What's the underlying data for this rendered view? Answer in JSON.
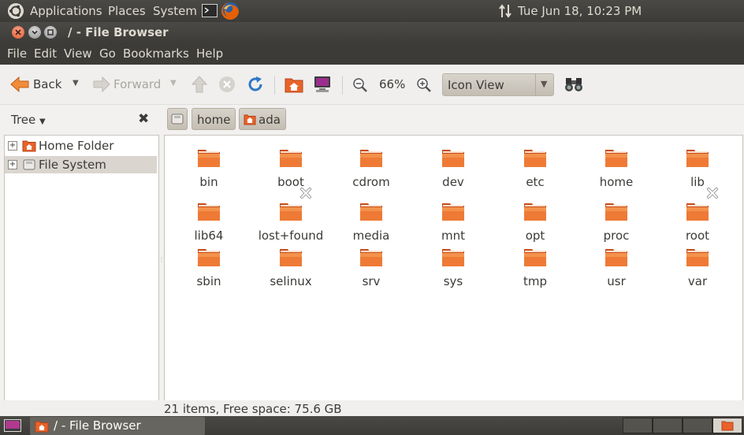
{
  "top_panel": {
    "menus": [
      "Applications",
      "Places",
      "System"
    ],
    "clock": "Tue Jun 18, 10:23 PM"
  },
  "window": {
    "title": "/ - File Browser"
  },
  "menubar": [
    "File",
    "Edit",
    "View",
    "Go",
    "Bookmarks",
    "Help"
  ],
  "toolbar": {
    "back_label": "Back",
    "forward_label": "Forward",
    "zoom_level": "66%",
    "view_mode": "Icon View"
  },
  "sidebar": {
    "header_label": "Tree",
    "items": [
      {
        "label": "Home Folder",
        "selected": false
      },
      {
        "label": "File System",
        "selected": true
      }
    ]
  },
  "pathbar": {
    "crumbs": [
      "home",
      "ada"
    ]
  },
  "files": [
    {
      "name": "bin",
      "restricted": false
    },
    {
      "name": "boot",
      "restricted": false
    },
    {
      "name": "cdrom",
      "restricted": false
    },
    {
      "name": "dev",
      "restricted": false
    },
    {
      "name": "etc",
      "restricted": false
    },
    {
      "name": "home",
      "restricted": false
    },
    {
      "name": "lib",
      "restricted": false
    },
    {
      "name": "lib64",
      "restricted": false
    },
    {
      "name": "lost+found",
      "restricted": true
    },
    {
      "name": "media",
      "restricted": false
    },
    {
      "name": "mnt",
      "restricted": false
    },
    {
      "name": "opt",
      "restricted": false
    },
    {
      "name": "proc",
      "restricted": false
    },
    {
      "name": "root",
      "restricted": true
    },
    {
      "name": "sbin",
      "restricted": false
    },
    {
      "name": "selinux",
      "restricted": false
    },
    {
      "name": "srv",
      "restricted": false
    },
    {
      "name": "sys",
      "restricted": false
    },
    {
      "name": "tmp",
      "restricted": false
    },
    {
      "name": "usr",
      "restricted": false
    },
    {
      "name": "var",
      "restricted": false
    }
  ],
  "status": "21 items, Free space: 75.6 GB",
  "taskbar": {
    "task_label": "/ - File Browser"
  },
  "colors": {
    "panel": "#3c3b37",
    "panel_text": "#dfdbd2",
    "folder_orange": "#e9622a",
    "selection": "#dad6cf"
  }
}
